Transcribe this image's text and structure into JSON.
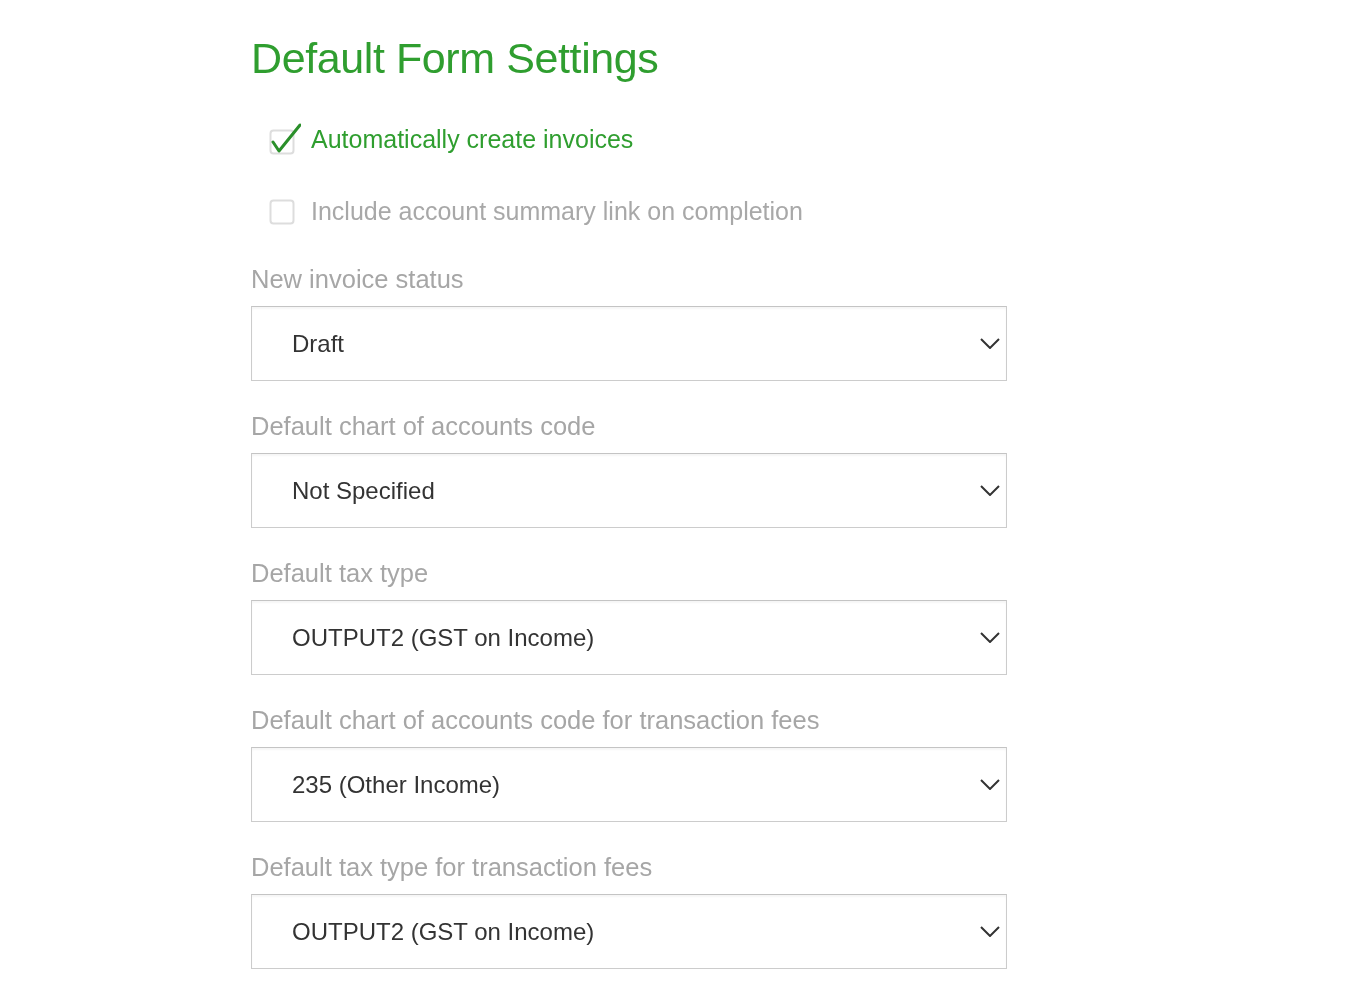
{
  "title": "Default Form Settings",
  "checkboxes": [
    {
      "label": "Automatically create invoices",
      "checked": true
    },
    {
      "label": "Include account summary link on completion",
      "checked": false
    }
  ],
  "selects": [
    {
      "label": "New invoice status",
      "value": "Draft"
    },
    {
      "label": "Default chart of accounts code",
      "value": "Not Specified"
    },
    {
      "label": "Default tax type",
      "value": "OUTPUT2 (GST on Income)"
    },
    {
      "label": "Default chart of accounts code for transaction fees",
      "value": "235 (Other Income)"
    },
    {
      "label": "Default tax type for transaction fees",
      "value": "OUTPUT2 (GST on Income)"
    }
  ]
}
